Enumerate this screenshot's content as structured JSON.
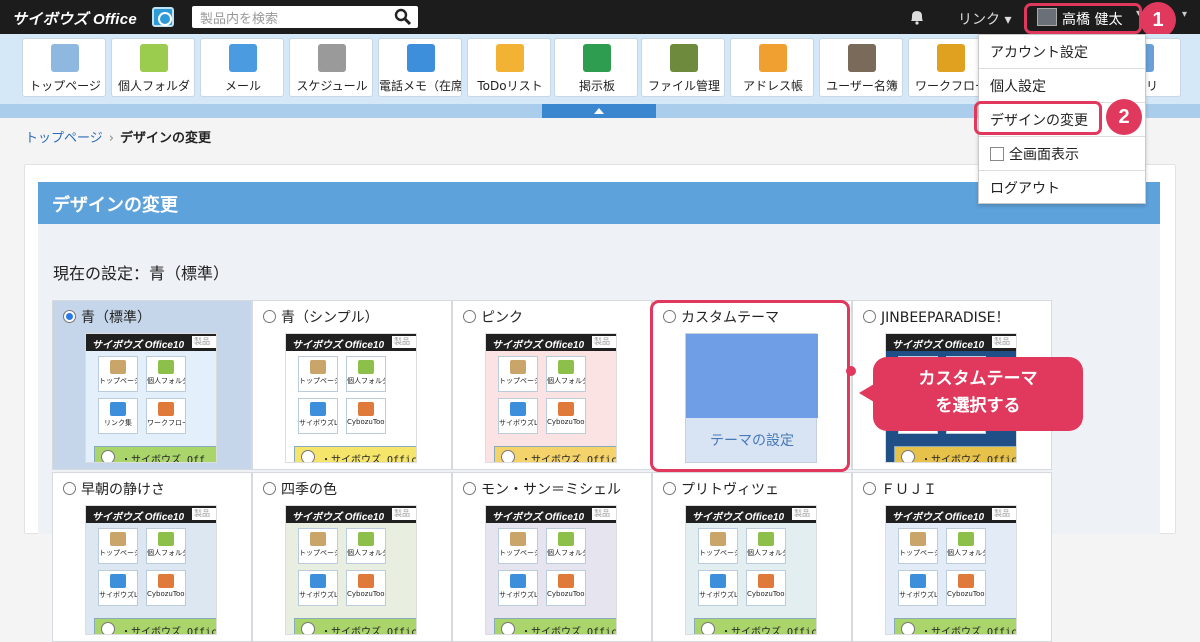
{
  "header": {
    "logo_text": "サイボウズ Office",
    "search_placeholder": "製品内を検索",
    "link_menu": "リンク ▾",
    "user_name": "高橋 健太",
    "caret": "▾"
  },
  "callouts": {
    "step1": "1",
    "step2": "2",
    "bubble_line1": "カスタムテーマ",
    "bubble_line2": "を選択する"
  },
  "nav": {
    "apps": [
      {
        "label": "トップページ",
        "icon": "home-icon",
        "color": "#8fb8e0"
      },
      {
        "label": "個人フォルダ",
        "icon": "folder-icon",
        "color": "#9ccc4e"
      },
      {
        "label": "メール",
        "icon": "mail-icon",
        "color": "#4b9be0"
      },
      {
        "label": "スケジュール",
        "icon": "calendar-icon",
        "color": "#9a9a9a"
      },
      {
        "label": "電話メモ（在席",
        "icon": "phone-memo-icon",
        "color": "#3d8edb"
      },
      {
        "label": "ToDoリスト",
        "icon": "todo-icon",
        "color": "#f2b233"
      },
      {
        "label": "掲示板",
        "icon": "bulletin-board-icon",
        "color": "#2e9d4f"
      },
      {
        "label": "ファイル管理",
        "icon": "file-binder-icon",
        "color": "#6e8b3d"
      },
      {
        "label": "アドレス帳",
        "icon": "address-book-icon",
        "color": "#f0a030"
      },
      {
        "label": "ユーザー名簿",
        "icon": "user-roster-icon",
        "color": "#7a6a5a"
      },
      {
        "label": "ワークフロー",
        "icon": "workflow-stamp-icon",
        "color": "#e0a020"
      },
      {
        "label": "アプリ",
        "icon": "app-icon",
        "color": "#6aa0d8"
      }
    ]
  },
  "dropdown": {
    "items": [
      "アカウント設定",
      "個人設定",
      "デザインの変更",
      "全画面表示",
      "ログアウト"
    ]
  },
  "breadcrumb": {
    "home": "トップページ",
    "separator": "›",
    "current": "デザインの変更"
  },
  "panel": {
    "title": "デザインの変更",
    "current_setting": "現在の設定：青（標準）"
  },
  "themes": [
    {
      "name": "青（標準）",
      "selected": true
    },
    {
      "name": "青（シンプル）",
      "selected": false
    },
    {
      "name": "ピンク",
      "selected": false
    },
    {
      "name": "カスタムテーマ",
      "selected": false
    },
    {
      "name": "JINBEEPARADISE！",
      "selected": false
    },
    {
      "name": "早朝の静けさ",
      "selected": false
    },
    {
      "name": "四季の色",
      "selected": false
    },
    {
      "name": "モン・サン＝ミシェル",
      "selected": false
    },
    {
      "name": "プリトヴィツェ",
      "selected": false
    },
    {
      "name": "ＦＵＪＩ",
      "selected": false
    }
  ],
  "thumbnail": {
    "logo": "サイボウズ Office10",
    "search_stub": "製品",
    "tiles_std": [
      "トップページ",
      "個人フォルダ",
      "リンク集",
      "ワークフロー"
    ],
    "tiles_alt": [
      "トップページ",
      "個人フォルダ",
      "サイボウズLive",
      "CybozuTools"
    ],
    "info_std": "・サイボウズ Off",
    "info_alt": "・サイボウズ Offic"
  },
  "custom_theme": {
    "button_label": "テーマの設定"
  }
}
